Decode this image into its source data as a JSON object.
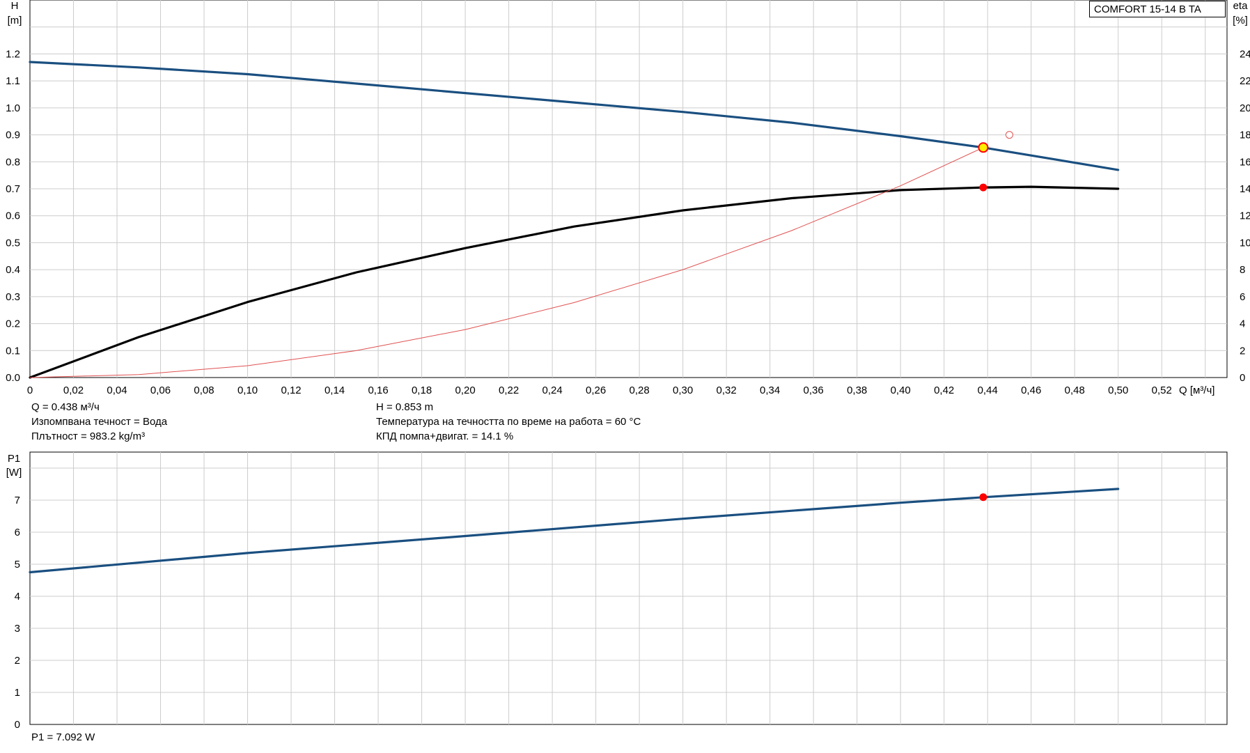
{
  "pump_name": "COMFORT 15-14 B TA",
  "colors": {
    "head_curve": "#1a4f80",
    "efficiency_curve": "#000000",
    "system_curve": "#e05050",
    "power_curve": "#1a4f80",
    "duty_point": "#ff0000",
    "duty_point_fill_head": "#ffee00",
    "grid": "#cccccc"
  },
  "info": {
    "q": "Q = 0.438 м³/ч",
    "h": "H = 0.853 m",
    "liquid": "Изпомпвана течност = Вода",
    "temperature": "Температура на течността по време на работа = 60 °C",
    "density": "Плътност = 983.2 kg/m³",
    "efficiency": "КПД помпа+двигат. = 14.1 %",
    "p1": "P1 = 7.092 W"
  },
  "chart_data": [
    {
      "type": "line",
      "name": "performance",
      "xlabel": "Q [м³/ч]",
      "ylabel_left": [
        "H",
        "[m]"
      ],
      "ylabel_right": [
        "eta",
        "[%]"
      ],
      "xlim": [
        0,
        0.55
      ],
      "ylim_left": [
        0,
        1.4
      ],
      "ylim_right": [
        0,
        28
      ],
      "x_ticks": [
        "0",
        "0,02",
        "0,04",
        "0,06",
        "0,08",
        "0,10",
        "0,12",
        "0,14",
        "0,16",
        "0,18",
        "0,20",
        "0,22",
        "0,24",
        "0,26",
        "0,28",
        "0,30",
        "0,32",
        "0,34",
        "0,36",
        "0,38",
        "0,40",
        "0,42",
        "0,44",
        "0,46",
        "0,48",
        "0,50",
        "0,52"
      ],
      "y_ticks_left": [
        "0.0",
        "0.1",
        "0.2",
        "0.3",
        "0.4",
        "0.5",
        "0.6",
        "0.7",
        "0.8",
        "0.9",
        "1.0",
        "1.1",
        "1.2"
      ],
      "y_ticks_right": [
        "0",
        "2",
        "4",
        "6",
        "8",
        "10",
        "12",
        "14",
        "16",
        "18",
        "20",
        "22",
        "24"
      ],
      "grid": true,
      "series": [
        {
          "key": "head",
          "axis": "left",
          "x": [
            0,
            0.05,
            0.1,
            0.15,
            0.2,
            0.25,
            0.3,
            0.35,
            0.4,
            0.438,
            0.5
          ],
          "y": [
            1.17,
            1.15,
            1.125,
            1.09,
            1.055,
            1.02,
            0.985,
            0.945,
            0.895,
            0.853,
            0.77
          ]
        },
        {
          "key": "efficiency",
          "axis": "right",
          "x": [
            0,
            0.05,
            0.1,
            0.15,
            0.2,
            0.25,
            0.3,
            0.35,
            0.4,
            0.438,
            0.46,
            0.5
          ],
          "y": [
            0,
            3.0,
            5.6,
            7.8,
            9.6,
            11.2,
            12.4,
            13.3,
            13.9,
            14.1,
            14.15,
            14.0
          ]
        },
        {
          "key": "system",
          "axis": "left",
          "x": [
            0,
            0.05,
            0.1,
            0.15,
            0.2,
            0.25,
            0.3,
            0.35,
            0.4,
            0.438
          ],
          "y": [
            0,
            0.011,
            0.044,
            0.1,
            0.178,
            0.278,
            0.4,
            0.545,
            0.711,
            0.853
          ]
        }
      ],
      "duty_points": [
        {
          "series": "head",
          "x": 0.438,
          "y": 0.853
        },
        {
          "series": "efficiency",
          "x": 0.438,
          "y": 14.1
        }
      ],
      "requested_point": {
        "x": 0.45,
        "y": 0.9
      }
    },
    {
      "type": "line",
      "name": "power",
      "ylabel": [
        "P1",
        "[W]"
      ],
      "xlim": [
        0,
        0.55
      ],
      "ylim": [
        0,
        8.5
      ],
      "y_ticks": [
        "0",
        "1",
        "2",
        "3",
        "4",
        "5",
        "6",
        "7"
      ],
      "grid": true,
      "series": [
        {
          "key": "p1",
          "x": [
            0,
            0.1,
            0.2,
            0.3,
            0.4,
            0.438,
            0.5
          ],
          "y": [
            4.75,
            5.35,
            5.88,
            6.42,
            6.92,
            7.092,
            7.35
          ]
        }
      ],
      "duty_points": [
        {
          "series": "p1",
          "x": 0.438,
          "y": 7.092
        }
      ]
    }
  ]
}
